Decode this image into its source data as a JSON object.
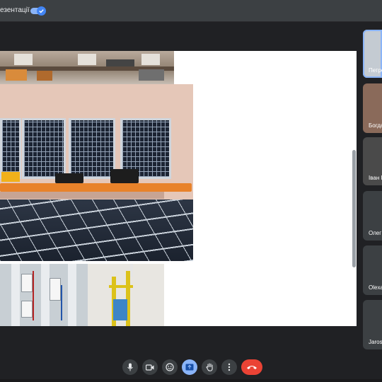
{
  "top_bar": {
    "present_label": "езентації",
    "toggle_state": "on"
  },
  "slide": {
    "images": [
      "lab-photo",
      "solar-panels-photo",
      "electrical-cabinet-photo",
      "test-stand-photo"
    ]
  },
  "participants": [
    {
      "name": "Петро",
      "active": true
    },
    {
      "name": "Богда",
      "active": false
    },
    {
      "name": "Іван І",
      "active": false
    },
    {
      "name": "Олег",
      "active": false
    },
    {
      "name": "Olexa",
      "active": false
    },
    {
      "name": "Jaros",
      "active": false
    }
  ],
  "controls": [
    {
      "id": "mic",
      "icon": "microphone-icon"
    },
    {
      "id": "camera",
      "icon": "camera-icon"
    },
    {
      "id": "reactions",
      "icon": "emoji-icon"
    },
    {
      "id": "present",
      "icon": "present-screen-icon",
      "active": true
    },
    {
      "id": "raise-hand",
      "icon": "hand-icon"
    },
    {
      "id": "more",
      "icon": "more-vert-icon"
    },
    {
      "id": "leave",
      "icon": "end-call-icon",
      "color": "#ea4335"
    }
  ],
  "colors": {
    "background": "#202124",
    "accent": "#8ab4f8",
    "end_call": "#ea4335"
  }
}
